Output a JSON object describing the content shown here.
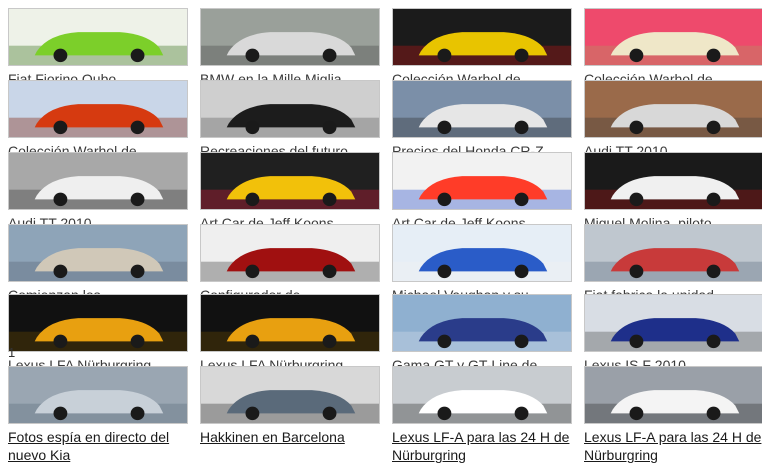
{
  "gallery": {
    "items": [
      {
        "caption": "Fiat Fiorino Qubo",
        "icon": "car-photo"
      },
      {
        "caption": "BMW en la Mille Miglia",
        "icon": "car-photo"
      },
      {
        "caption": "Colección Warhol de",
        "icon": "car-photo"
      },
      {
        "caption": "Colección Warhol de",
        "icon": "car-photo"
      },
      {
        "caption": "Colección Warhol de",
        "icon": "car-photo"
      },
      {
        "caption": "Recreaciones del futuro",
        "icon": "car-photo"
      },
      {
        "caption": "Precios del Honda CR-Z",
        "icon": "car-photo"
      },
      {
        "caption": "Audi TT 2010",
        "icon": "car-photo"
      },
      {
        "caption": "Audi TT 2010",
        "icon": "car-photo"
      },
      {
        "caption": "Art Car de Jeff Koons",
        "icon": "car-photo"
      },
      {
        "caption": "Art Car de Jeff Koons",
        "icon": "car-photo"
      },
      {
        "caption": "Miguel Molina, piloto",
        "icon": "person-photo"
      },
      {
        "caption": "Comienzan los",
        "icon": "city-photo"
      },
      {
        "caption": "Configurador de",
        "icon": "car-photo"
      },
      {
        "caption": "Michael Vaughan y su",
        "icon": "person-photo"
      },
      {
        "caption": "Fiat fabrica la unidad",
        "icon": "crowd-photo"
      },
      {
        "caption": "Lexus LFA Nürburgring",
        "icon": "car-photo"
      },
      {
        "caption": "Lexus LFA Nürburgring",
        "icon": "car-photo"
      },
      {
        "caption": "Gama GT y GT-Line de",
        "icon": "car-photo"
      },
      {
        "caption": "Lexus IS F 2010",
        "icon": "car-photo"
      },
      {
        "caption": "Fotos espía en directo del nuevo Kia",
        "icon": "car-photo"
      },
      {
        "caption": "Hakkinen en Barcelona",
        "icon": "person-photo"
      },
      {
        "caption": "Lexus LF-A para las 24 H de Nürburgring",
        "icon": "car-photo"
      },
      {
        "caption": "Lexus LF-A para las 24 H de Nürburgring",
        "icon": "car-photo"
      }
    ],
    "stray_number": "1"
  },
  "colors": {
    "border": "#c8c8c8",
    "text": "#3a3a3a"
  }
}
